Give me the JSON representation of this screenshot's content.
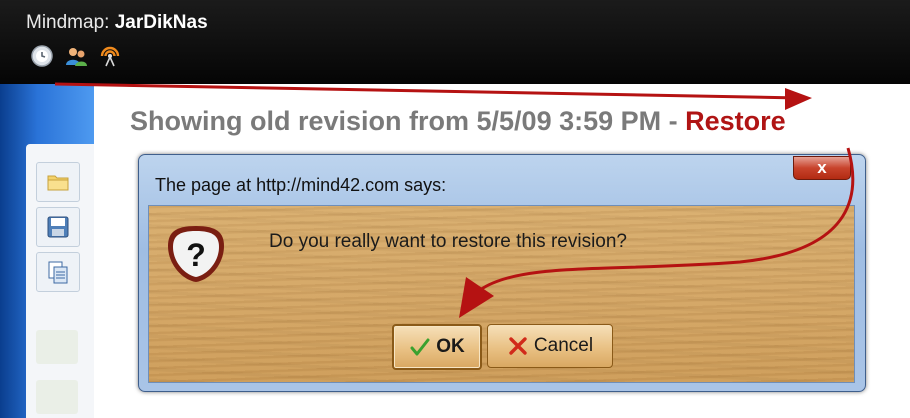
{
  "app": {
    "title_prefix": "Mindmap:",
    "map_name": "JarDikNas"
  },
  "toolbar": {
    "icons": [
      "clock-icon",
      "users-icon",
      "broadcast-icon"
    ]
  },
  "sidebar": {
    "buttons": [
      "open-folder-icon",
      "save-disk-icon",
      "copy-document-icon"
    ]
  },
  "revision": {
    "text": "Showing old revision from 5/5/09 3:59 PM - ",
    "restore_label": "Restore"
  },
  "dialog": {
    "title": "The page at http://mind42.com says:",
    "close_label": "x",
    "message": "Do you really want to restore this revision?",
    "ok_label": "OK",
    "cancel_label": "Cancel"
  },
  "colors": {
    "annotation_arrow": "#b51212",
    "restore_link": "#b01414",
    "dialog_frame": "#a9c4e7"
  }
}
